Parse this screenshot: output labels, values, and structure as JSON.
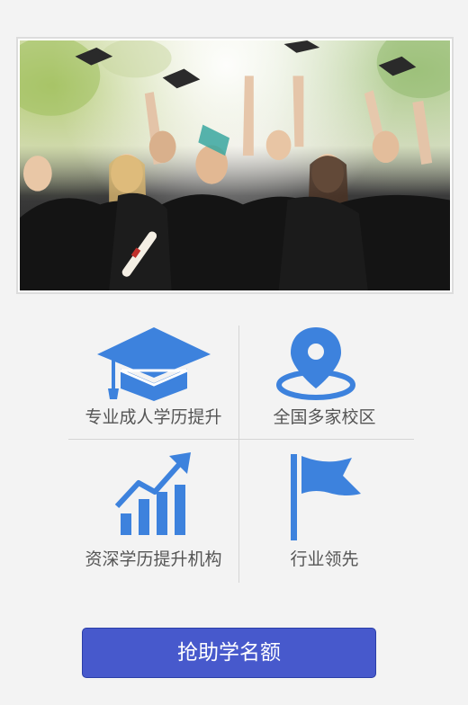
{
  "hero": {
    "image_subject": "graduates in black gowns throwing caps outdoors"
  },
  "features": [
    {
      "label": "专业成人学历提升",
      "icon": "graduation-cap-icon"
    },
    {
      "label": "全国多家校区",
      "icon": "location-pin-icon"
    },
    {
      "label": "资深学历提升机构",
      "icon": "growth-bar-chart-icon"
    },
    {
      "label": "行业领先",
      "icon": "flag-icon"
    }
  ],
  "cta": {
    "label": "抢助学名额"
  },
  "colors": {
    "background": "#f3f3f3",
    "icon_blue": "#3d82dd",
    "label_gray": "#555555",
    "divider": "#d5d5d5",
    "cta_bg": "#4759cc",
    "cta_border": "#2a3ea8",
    "cta_text": "#ffffff"
  }
}
